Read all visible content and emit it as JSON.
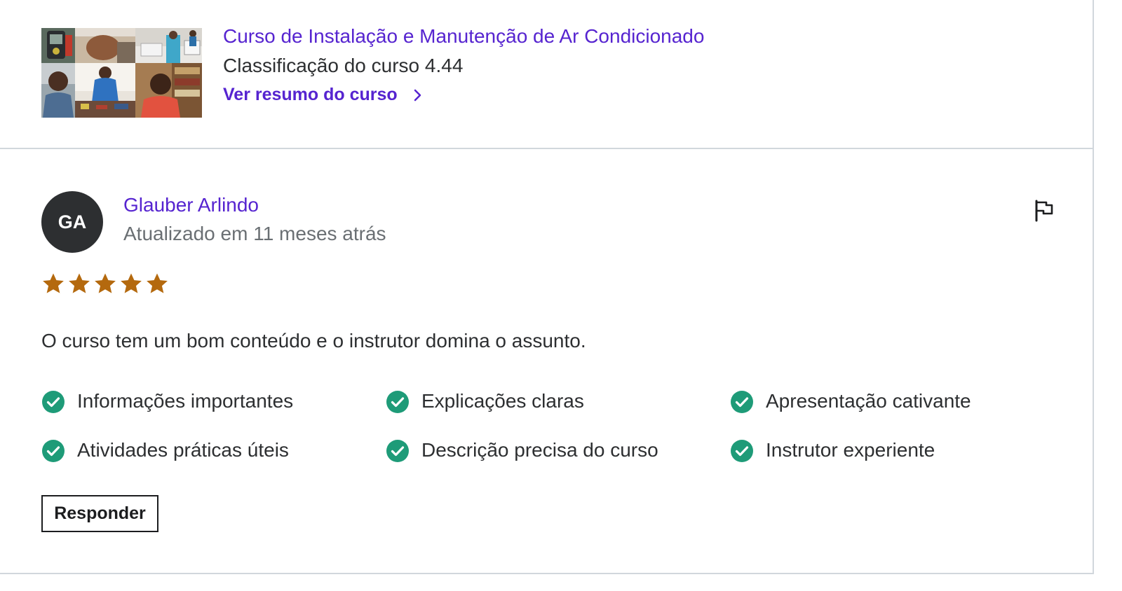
{
  "course": {
    "title": "Curso de Instalação e Manutenção de Ar Condicionado",
    "rating_text": "Classificação do curso 4.44",
    "summary_link": "Ver resumo do curso",
    "summary_link_icon": "chevron-right-icon",
    "thumbnail": "course-thumbnail-collage"
  },
  "review": {
    "avatar_initials": "GA",
    "reviewer_name": "Glauber Arlindo",
    "updated": "Atualizado em 11 meses atrás",
    "rating": 5,
    "rating_max": 5,
    "text": "O curso tem um bom conteúdo e o instrutor domina o assunto.",
    "report_icon": "flag-icon",
    "attributes": [
      "Informações importantes",
      "Explicações claras",
      "Apresentação cativante",
      "Atividades práticas úteis",
      "Descrição precisa do curso",
      "Instrutor experiente"
    ],
    "reply_label": "Responder"
  },
  "colors": {
    "link": "#5624d0",
    "star": "#b4690e",
    "check": "#1e9b78",
    "avatar_bg": "#2d2f31",
    "muted_text": "#6a6f73",
    "border": "#d1d7dc"
  }
}
